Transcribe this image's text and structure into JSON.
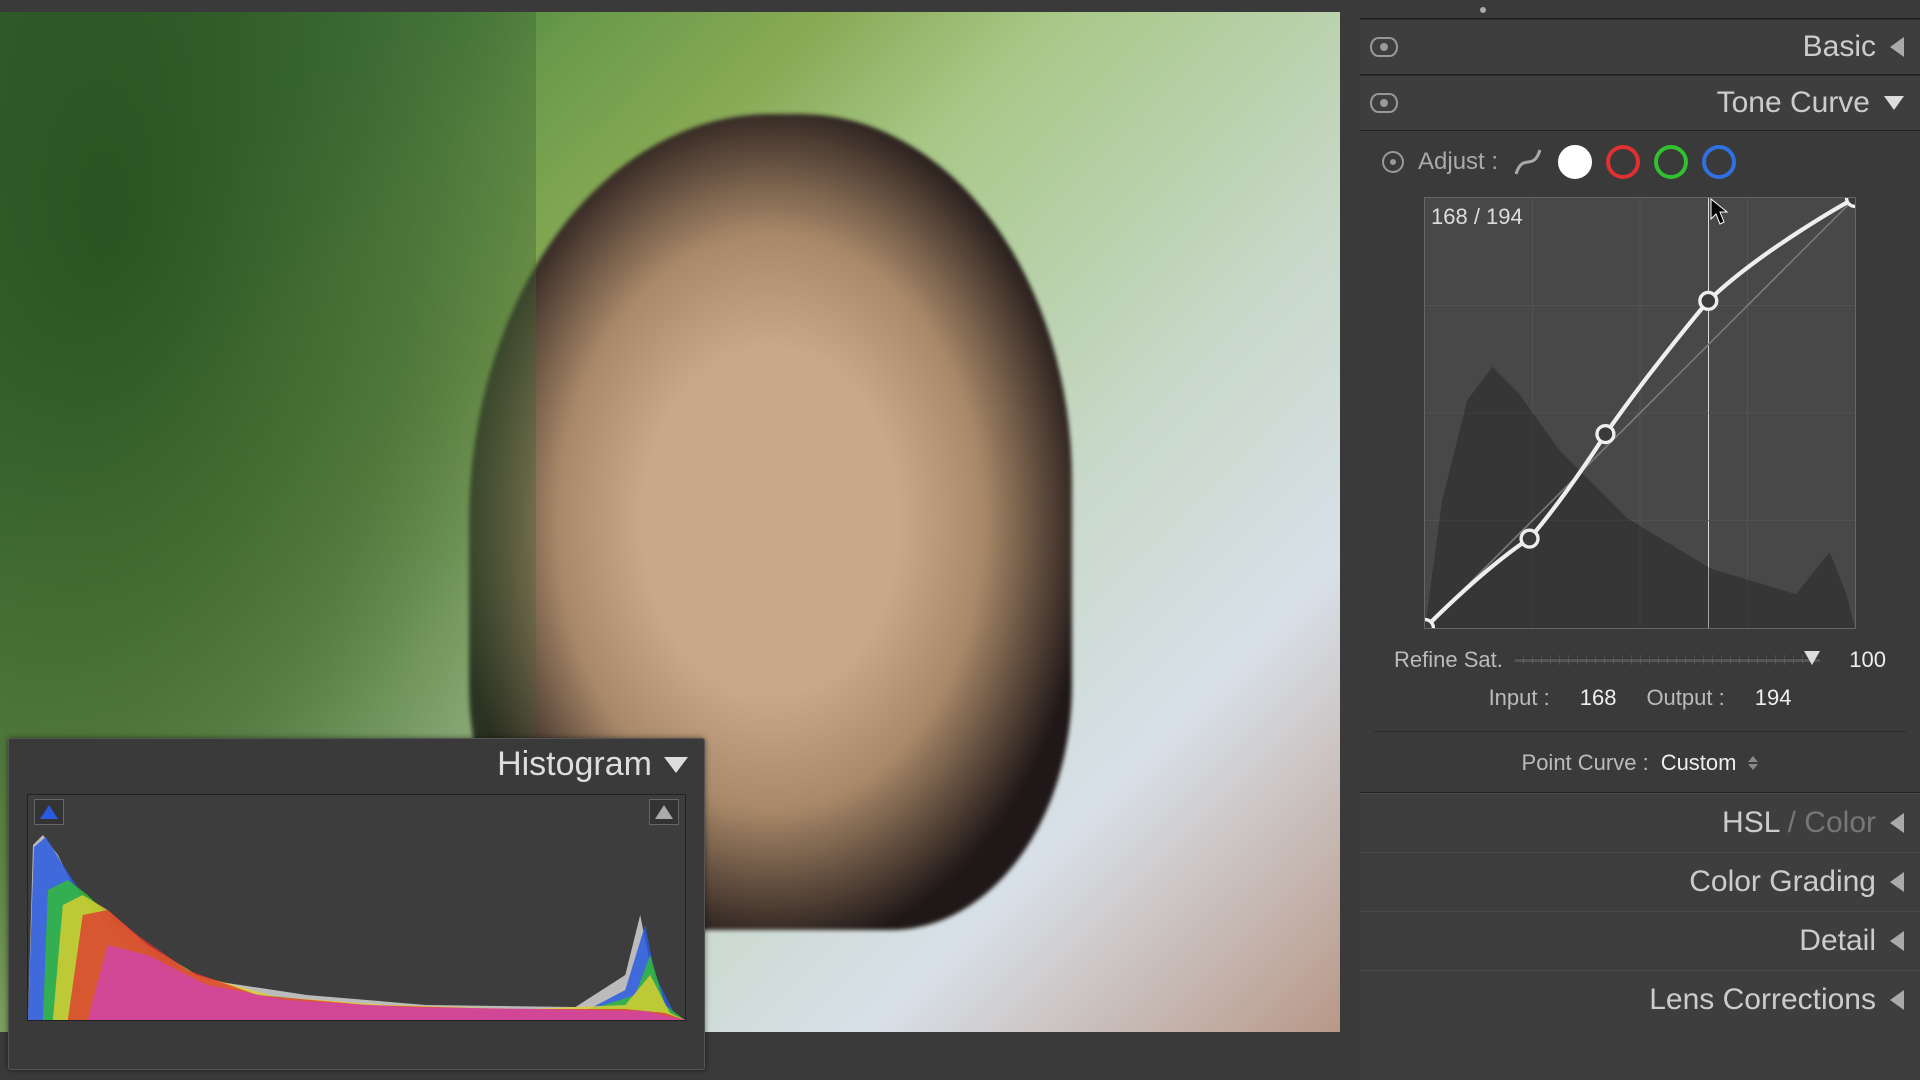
{
  "histogram": {
    "title": "Histogram"
  },
  "right_panel": {
    "basic": {
      "label": "Basic"
    },
    "tone_curve": {
      "label": "Tone Curve",
      "adjust_label": "Adjust :",
      "readout": "168 / 194",
      "curve_points": [
        {
          "in": 0,
          "out": 0
        },
        {
          "in": 62,
          "out": 53
        },
        {
          "in": 107,
          "out": 115
        },
        {
          "in": 168,
          "out": 194
        },
        {
          "in": 255,
          "out": 255
        }
      ],
      "refine_sat_label": "Refine Sat.",
      "refine_sat_value": "100",
      "input_label": "Input :",
      "input_value": "168",
      "output_label": "Output :",
      "output_value": "194",
      "point_curve_label": "Point Curve :",
      "point_curve_value": "Custom"
    },
    "hsl": {
      "label_a": "HSL",
      "label_b": " / Color"
    },
    "color_grading": {
      "label": "Color Grading"
    },
    "detail": {
      "label": "Detail"
    },
    "lens": {
      "label": "Lens Corrections"
    }
  }
}
